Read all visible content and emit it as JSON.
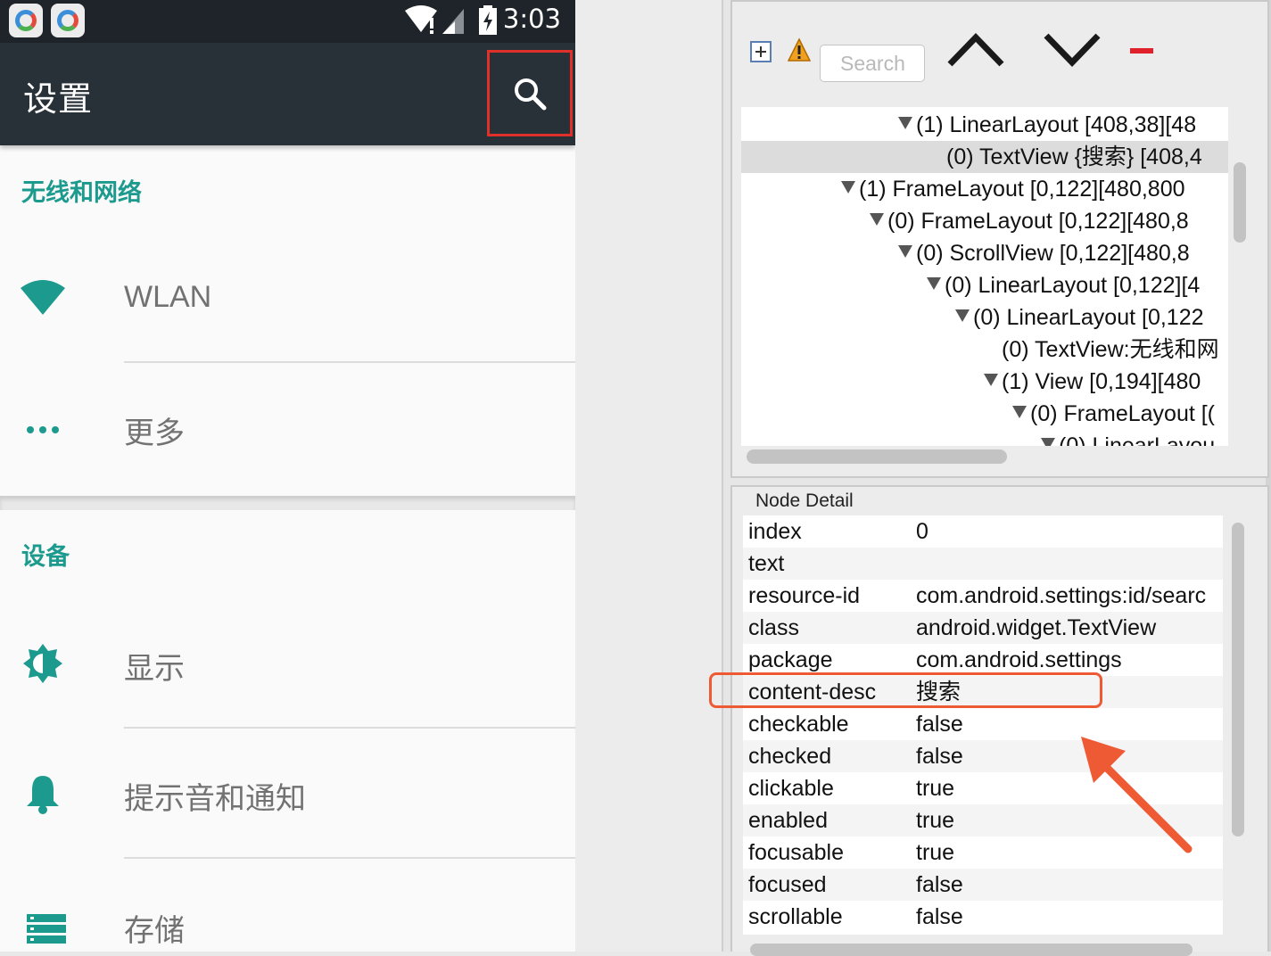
{
  "phone": {
    "status_bar": {
      "time": "3:03",
      "icons": [
        "app-icon",
        "app-icon",
        "wifi-icon",
        "signal-icon",
        "battery-charging-icon"
      ]
    },
    "toolbar": {
      "title": "设置",
      "search_icon": "search-icon"
    },
    "sections": [
      {
        "header": "无线和网络",
        "items": [
          {
            "label": "WLAN",
            "icon": "wifi-icon"
          },
          {
            "label": "更多",
            "icon": "more-dots-icon"
          }
        ]
      },
      {
        "header": "设备",
        "items": [
          {
            "label": "显示",
            "icon": "brightness-icon"
          },
          {
            "label": "提示音和通知",
            "icon": "bell-icon"
          },
          {
            "label": "存储",
            "icon": "storage-icon"
          }
        ]
      }
    ],
    "colors": {
      "accent": "#1d9a8e",
      "toolbar": "#283038",
      "statusbar": "#1f242b",
      "highlight": "#e0302a"
    }
  },
  "viewer": {
    "toolbar": {
      "search_placeholder": "Search",
      "icons": [
        "expand-all-icon",
        "warning-icon",
        "chevron-up-icon",
        "chevron-down-icon",
        "minus-icon"
      ]
    },
    "tree": [
      {
        "text": "(1) LinearLayout [408,38][48",
        "expanded": true
      },
      {
        "text": "(0) TextView {搜索} [408,4",
        "expanded": false,
        "selected": true
      },
      {
        "text": "(1) FrameLayout [0,122][480,800",
        "expanded": true
      },
      {
        "text": "(0) FrameLayout [0,122][480,8",
        "expanded": true
      },
      {
        "text": "(0) ScrollView [0,122][480,8",
        "expanded": true
      },
      {
        "text": "(0) LinearLayout [0,122][4",
        "expanded": true
      },
      {
        "text": "(0) LinearLayout [0,122",
        "expanded": true
      },
      {
        "text": "(0) TextView:无线和网",
        "expanded": false
      },
      {
        "text": "(1) View [0,194][480",
        "expanded": true
      },
      {
        "text": "(0) FrameLayout [(",
        "expanded": true
      },
      {
        "text": "(0) LinearLayou",
        "expanded": true
      }
    ],
    "node_detail": {
      "title": "Node Detail",
      "rows": [
        {
          "key": "index",
          "value": "0"
        },
        {
          "key": "text",
          "value": ""
        },
        {
          "key": "resource-id",
          "value": "com.android.settings:id/searc"
        },
        {
          "key": "class",
          "value": "android.widget.TextView"
        },
        {
          "key": "package",
          "value": "com.android.settings"
        },
        {
          "key": "content-desc",
          "value": "搜索"
        },
        {
          "key": "checkable",
          "value": "false"
        },
        {
          "key": "checked",
          "value": "false"
        },
        {
          "key": "clickable",
          "value": "true"
        },
        {
          "key": "enabled",
          "value": "true"
        },
        {
          "key": "focusable",
          "value": "true"
        },
        {
          "key": "focused",
          "value": "false"
        },
        {
          "key": "scrollable",
          "value": "false"
        }
      ]
    },
    "annotation_color": "#ee5a33"
  }
}
